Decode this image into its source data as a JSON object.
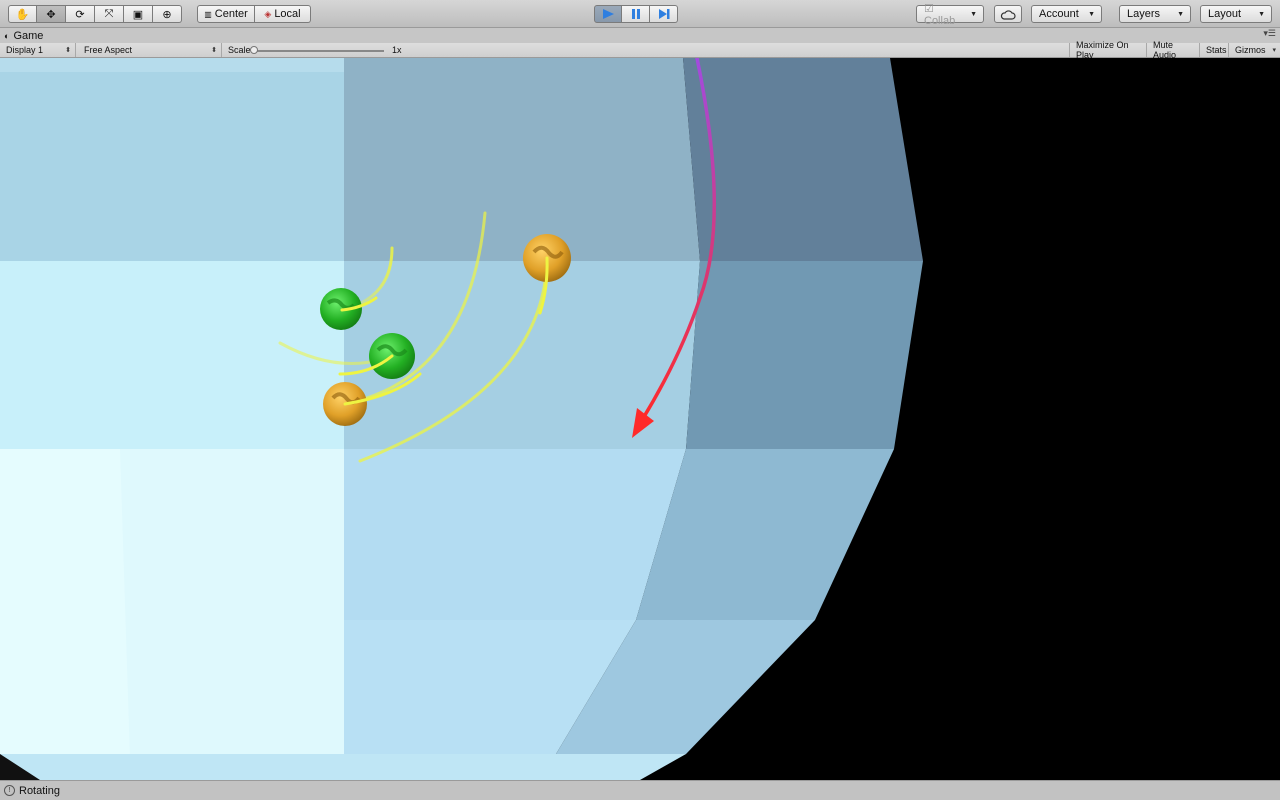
{
  "toolbar": {
    "tools": [
      {
        "name": "hand-tool",
        "icon": "hand-icon",
        "glyph": "✋"
      },
      {
        "name": "move-tool",
        "icon": "move-icon",
        "glyph": "✥"
      },
      {
        "name": "rotate-tool",
        "icon": "rotate-icon",
        "glyph": "⟳"
      },
      {
        "name": "scale-tool",
        "icon": "scale-icon",
        "glyph": "⤧"
      },
      {
        "name": "rect-tool",
        "icon": "rect-icon",
        "glyph": "▣"
      },
      {
        "name": "transform-tool",
        "icon": "transform-icon",
        "glyph": "⊕"
      }
    ],
    "pivot_mode": "Center",
    "pivot_rotation": "Local",
    "collab_label": "Collab",
    "account_label": "Account",
    "layers_label": "Layers",
    "layout_label": "Layout"
  },
  "tab": {
    "title": "Game"
  },
  "game_toolbar": {
    "display": "Display 1",
    "aspect": "Free Aspect",
    "scale_label": "Scale",
    "scale_value": "1x",
    "maximize_on_play": "Maximize On Play",
    "mute_audio": "Mute Audio",
    "stats": "Stats",
    "gizmos": "Gizmos"
  },
  "status": {
    "text": "Rotating"
  },
  "colors": {
    "play_active": "#2f7fe0",
    "arrow_start": "#a24be0",
    "arrow_end": "#ff2a2a",
    "trail": "#eef442",
    "ball_green": "#2fbf2f",
    "ball_orange": "#e3a52a",
    "background": "#000000"
  }
}
